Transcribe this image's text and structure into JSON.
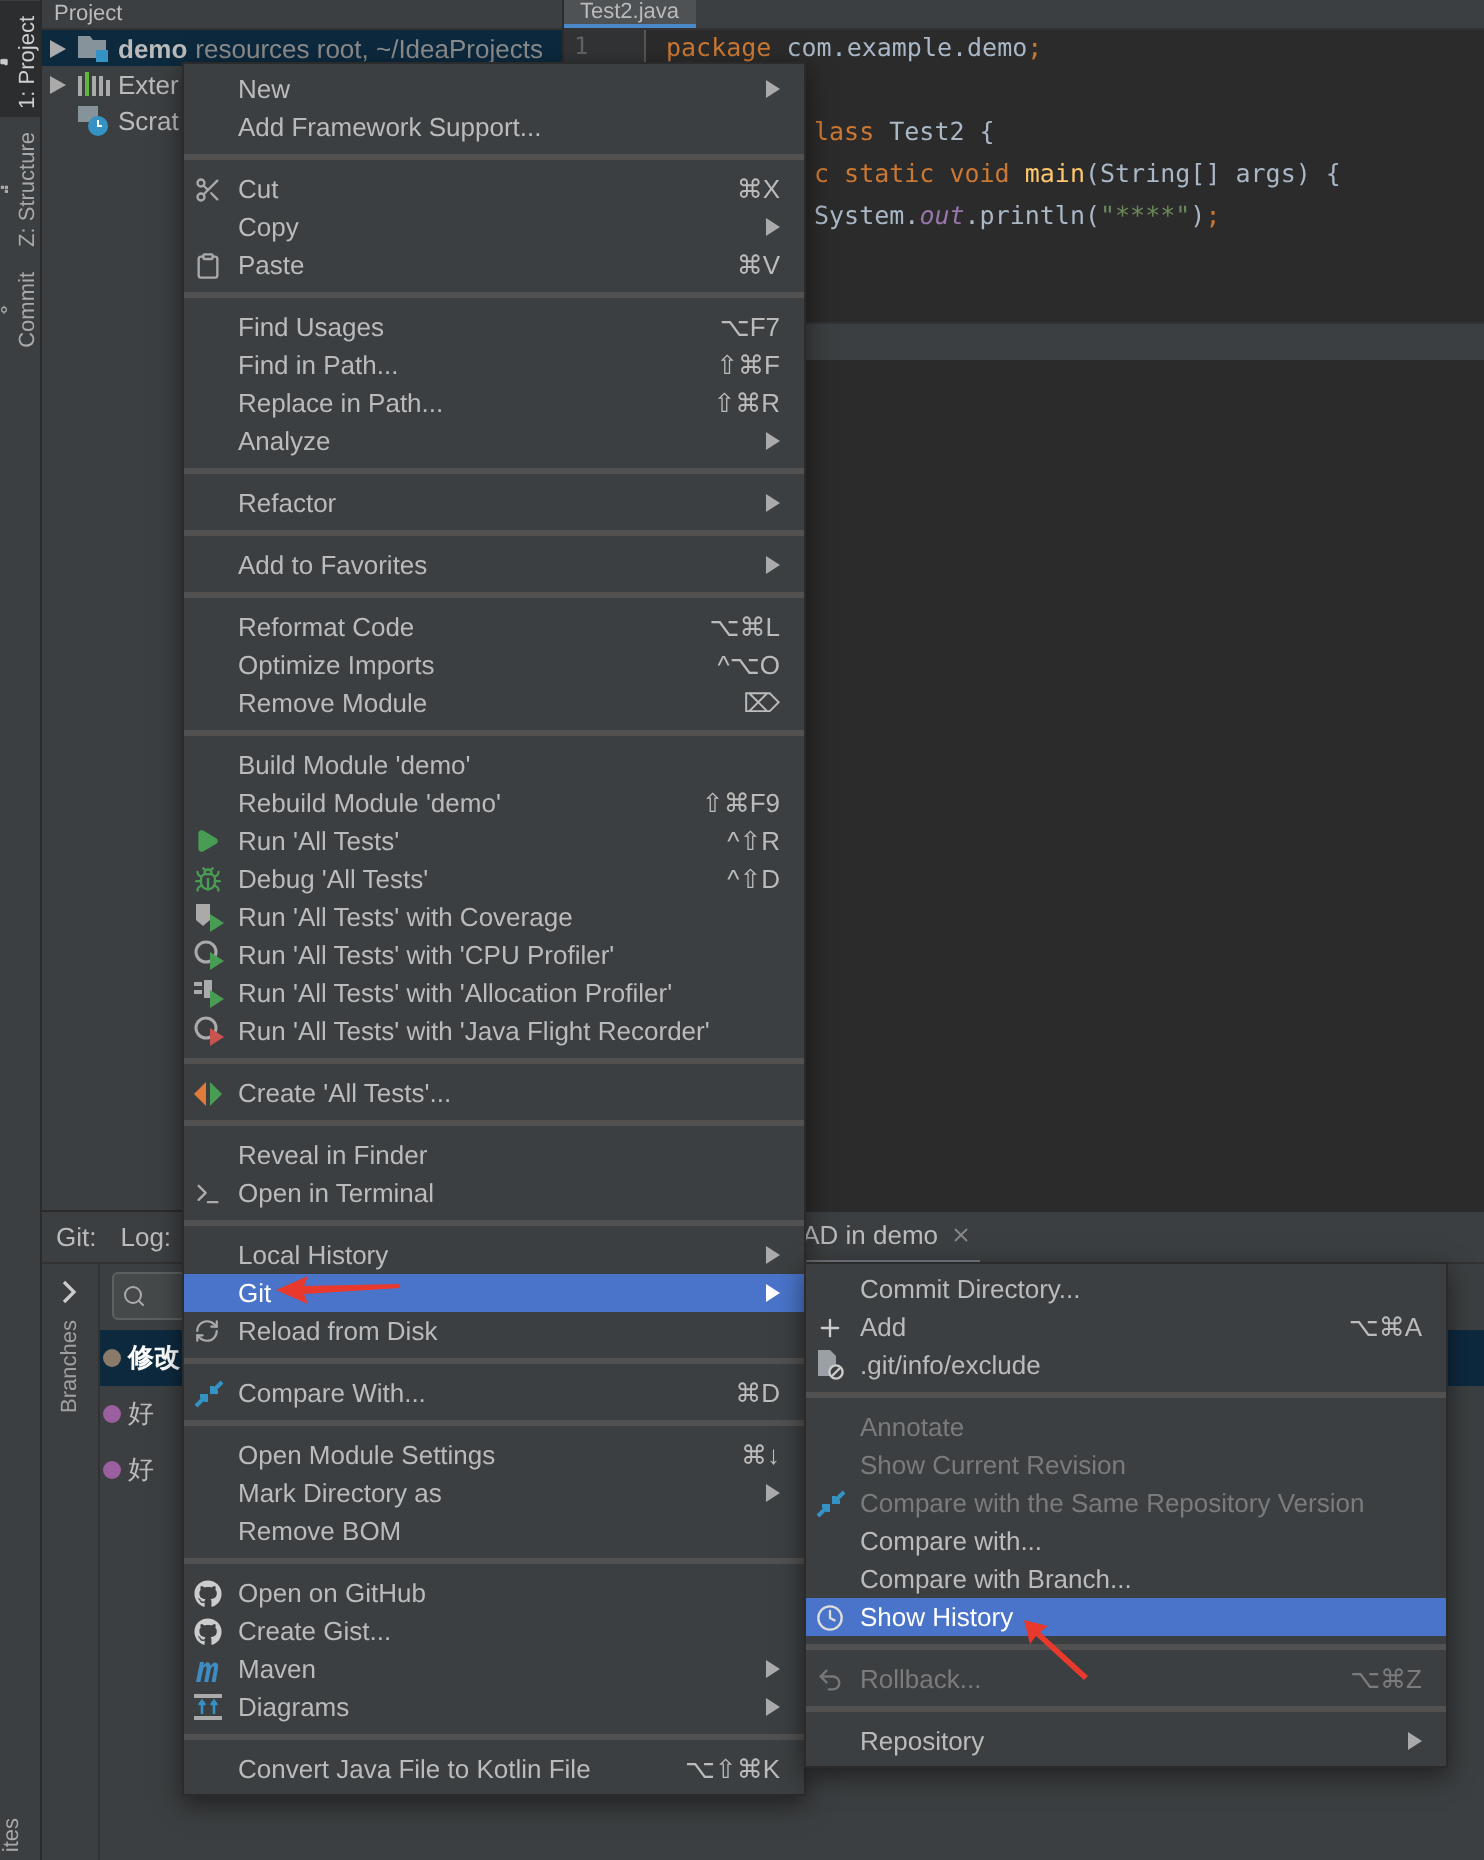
{
  "tool_strip": [
    {
      "label": "1: Project",
      "selected": true
    },
    {
      "label": "Z: Structure",
      "selected": false
    },
    {
      "label": "Commit",
      "selected": false
    },
    {
      "label": "ites",
      "selected": false
    }
  ],
  "project_panel": {
    "title": "Project",
    "tree": [
      {
        "label": "demo",
        "note": "resources root, ~/IdeaProjects",
        "kind": "module",
        "expandable": true,
        "selected": true
      },
      {
        "label": "Exter",
        "kind": "library",
        "expandable": true,
        "selected": false
      },
      {
        "label": "Scrat",
        "kind": "scratch",
        "expandable": false,
        "selected": false
      }
    ]
  },
  "editor": {
    "tab": "Test2.java",
    "line_numbers": [
      "1"
    ],
    "lines": [
      [
        {
          "t": "package",
          "kind": "keyword"
        },
        {
          "t": " com.example.demo",
          "kind": "plain"
        },
        {
          "t": ";",
          "kind": "keyword"
        }
      ],
      [
        {
          "t": "lass",
          "kind": "keyword"
        },
        {
          "t": " Test2 {",
          "kind": "plain"
        }
      ],
      [
        {
          "t": "c static void",
          "kind": "keyword"
        },
        {
          "t": " main",
          "kind": "method"
        },
        {
          "t": "(String[] args) {",
          "kind": "plain"
        }
      ],
      [
        {
          "t": "System.",
          "kind": "plain"
        },
        {
          "t": "out",
          "kind": "field"
        },
        {
          "t": ".println(",
          "kind": "plain"
        },
        {
          "t": "\"****\"",
          "kind": "string"
        },
        {
          "t": ")",
          "kind": "plain"
        },
        {
          "t": ";",
          "kind": "keyword"
        }
      ]
    ]
  },
  "git_panel": {
    "labels": [
      "Git:",
      "Log:"
    ],
    "tab": "AD in demo",
    "side_label": "Branches",
    "commits": [
      {
        "message": "修改",
        "selected": true,
        "color": "#8a7a6a"
      },
      {
        "message": "好",
        "selected": false,
        "color": "#9b5fa0"
      },
      {
        "message": "好",
        "selected": false,
        "color": "#9b5fa0"
      }
    ]
  },
  "context_menu": [
    [
      {
        "label": "New",
        "kind": "plain",
        "submenu": true
      },
      {
        "label": "Add Framework Support...",
        "kind": "plain"
      }
    ],
    [
      {
        "label": "Cut",
        "kind": "scissors",
        "shortcut": "⌘X"
      },
      {
        "label": "Copy",
        "kind": "plain",
        "submenu": true
      },
      {
        "label": "Paste",
        "kind": "clipboard",
        "shortcut": "⌘V"
      }
    ],
    [
      {
        "label": "Find Usages",
        "kind": "plain",
        "shortcut": "⌥F7"
      },
      {
        "label": "Find in Path...",
        "kind": "plain",
        "shortcut": "⇧⌘F"
      },
      {
        "label": "Replace in Path...",
        "kind": "plain",
        "shortcut": "⇧⌘R"
      },
      {
        "label": "Analyze",
        "kind": "plain",
        "submenu": true
      }
    ],
    [
      {
        "label": "Refactor",
        "kind": "plain",
        "submenu": true
      }
    ],
    [
      {
        "label": "Add to Favorites",
        "kind": "plain",
        "submenu": true
      }
    ],
    [
      {
        "label": "Reformat Code",
        "kind": "plain",
        "shortcut": "⌥⌘L"
      },
      {
        "label": "Optimize Imports",
        "kind": "plain",
        "shortcut": "^⌥O"
      },
      {
        "label": "Remove Module",
        "kind": "plain",
        "shortcut": "⌦"
      }
    ],
    [
      {
        "label": "Build Module 'demo'",
        "kind": "plain"
      },
      {
        "label": "Rebuild Module 'demo'",
        "kind": "plain",
        "shortcut": "⇧⌘F9"
      },
      {
        "label": "Run 'All Tests'",
        "kind": "play",
        "shortcut": "^⇧R"
      },
      {
        "label": "Debug 'All Tests'",
        "kind": "bug",
        "shortcut": "^⇧D"
      },
      {
        "label": "Run 'All Tests' with Coverage",
        "kind": "coverage"
      },
      {
        "label": "Run 'All Tests' with 'CPU Profiler'",
        "kind": "profiler"
      },
      {
        "label": "Run 'All Tests' with 'Allocation Profiler'",
        "kind": "allocation"
      },
      {
        "label": "Run 'All Tests' with 'Java Flight Recorder'",
        "kind": "recorder"
      }
    ],
    [
      {
        "label": "Create 'All Tests'...",
        "kind": "create-test"
      }
    ],
    [
      {
        "label": "Reveal in Finder",
        "kind": "plain"
      },
      {
        "label": "Open in Terminal",
        "kind": "terminal"
      }
    ],
    [
      {
        "label": "Local History",
        "kind": "plain",
        "submenu": true
      },
      {
        "label": "Git",
        "kind": "plain",
        "submenu": true,
        "selected": true
      },
      {
        "label": "Reload from Disk",
        "kind": "refresh"
      }
    ],
    [
      {
        "label": "Compare With...",
        "kind": "compare",
        "shortcut": "⌘D"
      }
    ],
    [
      {
        "label": "Open Module Settings",
        "kind": "plain",
        "shortcut": "⌘↓"
      },
      {
        "label": "Mark Directory as",
        "kind": "plain",
        "submenu": true
      },
      {
        "label": "Remove BOM",
        "kind": "plain"
      }
    ],
    [
      {
        "label": "Open on GitHub",
        "kind": "github"
      },
      {
        "label": "Create Gist...",
        "kind": "github"
      },
      {
        "label": "Maven",
        "kind": "maven",
        "submenu": true
      },
      {
        "label": "Diagrams",
        "kind": "diagram",
        "submenu": true
      }
    ],
    [
      {
        "label": "Convert Java File to Kotlin File",
        "kind": "plain",
        "shortcut": "⌥⇧⌘K"
      }
    ]
  ],
  "git_submenu": [
    [
      {
        "label": "Commit Directory...",
        "kind": "plain"
      },
      {
        "label": "Add",
        "kind": "plus",
        "shortcut": "⌥⌘A"
      },
      {
        "label": ".git/info/exclude",
        "kind": "file-excluded"
      }
    ],
    [
      {
        "label": "Annotate",
        "kind": "plain",
        "disabled": true
      },
      {
        "label": "Show Current Revision",
        "kind": "plain",
        "disabled": true
      },
      {
        "label": "Compare with the Same Repository Version",
        "kind": "compare",
        "disabled": true
      },
      {
        "label": "Compare with...",
        "kind": "plain",
        "disabled": false
      },
      {
        "label": "Compare with Branch...",
        "kind": "plain",
        "disabled": false
      },
      {
        "label": "Show History",
        "kind": "clock",
        "selected": true
      }
    ],
    [
      {
        "label": "Rollback...",
        "kind": "rollback",
        "shortcut": "⌥⌘Z",
        "disabled": true
      }
    ],
    [
      {
        "label": "Repository",
        "kind": "plain",
        "submenu": true
      }
    ]
  ]
}
